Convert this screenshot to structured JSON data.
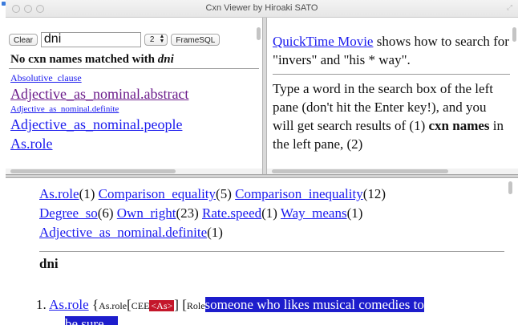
{
  "window": {
    "title": "Cxn Viewer by Hiroaki SATO"
  },
  "left_pane": {
    "clear_label": "Clear",
    "search_value": "dni",
    "select_value": "2",
    "framesql_label": "FrameSQL",
    "no_match_prefix": "No cxn names matched with ",
    "no_match_term": "dni",
    "cxn_links": [
      {
        "label": "Absolutive_clause",
        "size": "small",
        "visited": false
      },
      {
        "label": "Adjective_as_nominal.abstract",
        "size": "large",
        "visited": true
      },
      {
        "label": "Adjective_as_nominal.definite",
        "size": "mini",
        "visited": false
      },
      {
        "label": "Adjective_as_nominal.people",
        "size": "large",
        "visited": false
      },
      {
        "label": "As.role",
        "size": "large",
        "visited": false
      }
    ]
  },
  "right_pane": {
    "link_label": "QuickTime Movie",
    "intro_rest": " shows how to search for \"invers\" and \"his * way\".",
    "para_start": "Type a word in the search box of the left pane (don't hit the Enter key!), and you will get search results of (1) ",
    "para_bold": "cxn names",
    "para_end": " in the left pane, (2)"
  },
  "results": {
    "items": [
      {
        "name": "As.role",
        "count": "(1)"
      },
      {
        "name": "Comparison_equality",
        "count": "(5)"
      },
      {
        "name": "Comparison_inequality",
        "count": "(12)"
      },
      {
        "name": "Degree_so",
        "count": "(6)"
      },
      {
        "name": "Own_right",
        "count": "(23)"
      },
      {
        "name": "Rate.speed",
        "count": "(1)"
      },
      {
        "name": "Way_means",
        "count": "(1)"
      },
      {
        "name": "Adjective_as_nominal.definite",
        "count": "(1)"
      }
    ],
    "query": "dni",
    "example": {
      "number": "1.",
      "link": "As.role",
      "open1": " {",
      "sub1": "As.role",
      "open2": "[",
      "sub2": "CEE",
      "tag": "<As>",
      "close2": "] [",
      "sub3": "Role",
      "highlight": "someone who likes musical comedies to",
      "cut_text": "be sure ... "
    }
  }
}
